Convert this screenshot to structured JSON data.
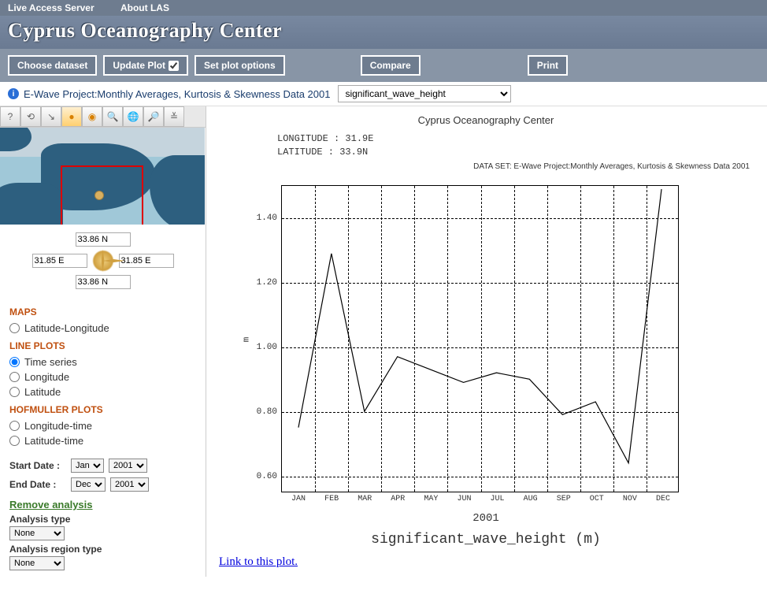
{
  "topnav": {
    "las": "Live Access Server",
    "about": "About LAS"
  },
  "header": {
    "title": "Cyprus Oceanography Center"
  },
  "buttons": {
    "choose": "Choose dataset",
    "update": "Update Plot",
    "options": "Set plot options",
    "compare": "Compare",
    "print": "Print"
  },
  "info": {
    "dataset": "E-Wave Project:Monthly Averages, Kurtosis & Skewness Data 2001",
    "variable": "significant_wave_height"
  },
  "coords": {
    "north": "33.86 N",
    "south": "33.86 N",
    "west": "31.85 E",
    "east": "31.85 E"
  },
  "nav": {
    "maps_head": "MAPS",
    "latlon": "Latitude-Longitude",
    "line_head": "LINE PLOTS",
    "timeseries": "Time series",
    "longitude": "Longitude",
    "latitude": "Latitude",
    "hof_head": "HOFMULLER PLOTS",
    "lon_time": "Longitude-time",
    "lat_time": "Latitude-time"
  },
  "dates": {
    "start_label": "Start Date :",
    "end_label": "End Date :",
    "start_month": "Jan",
    "start_year": "2001",
    "end_month": "Dec",
    "end_year": "2001"
  },
  "analysis": {
    "remove": "Remove analysis",
    "type_label": "Analysis type",
    "type_value": "None",
    "region_label": "Analysis region type",
    "region_value": "None"
  },
  "plot": {
    "center_title": "Cyprus Oceanography Center",
    "lon": "LONGITUDE : 31.9E",
    "lat": "LATITUDE : 33.9N",
    "dataset_line": "DATA SET: E-Wave Project:Monthly Averages, Kurtosis & Skewness Data 2001",
    "ylabel": "m",
    "xlabel": "2001",
    "varlabel": "significant_wave_height (m)",
    "link": "Link to this plot."
  },
  "chart_data": {
    "type": "line",
    "title": "significant_wave_height (m)",
    "xlabel": "2001",
    "ylabel": "m",
    "ylim": [
      0.55,
      1.5
    ],
    "yticks": [
      0.6,
      0.8,
      1.0,
      1.2,
      1.4
    ],
    "categories": [
      "JAN",
      "FEB",
      "MAR",
      "APR",
      "MAY",
      "JUN",
      "JUL",
      "AUG",
      "SEP",
      "OCT",
      "NOV",
      "DEC"
    ],
    "values": [
      0.75,
      1.29,
      0.8,
      0.97,
      0.93,
      0.89,
      0.92,
      0.9,
      0.79,
      0.83,
      0.64,
      1.49
    ]
  }
}
